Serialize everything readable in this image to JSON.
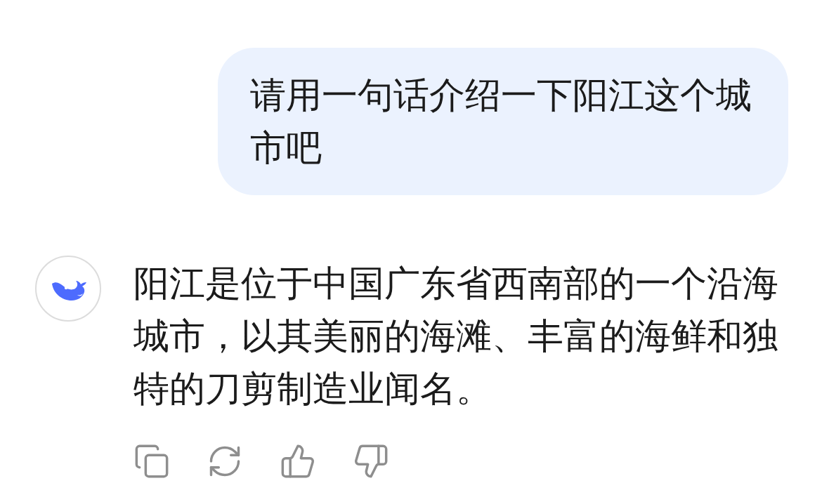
{
  "user_message": {
    "text": "请用一句话介绍一下阳江这个城市吧"
  },
  "assistant_message": {
    "text": "阳江是位于中国广东省西南部的一个沿海城市，以其美丽的海滩、丰富的海鲜和独特的刀剪制造业闻名。"
  }
}
